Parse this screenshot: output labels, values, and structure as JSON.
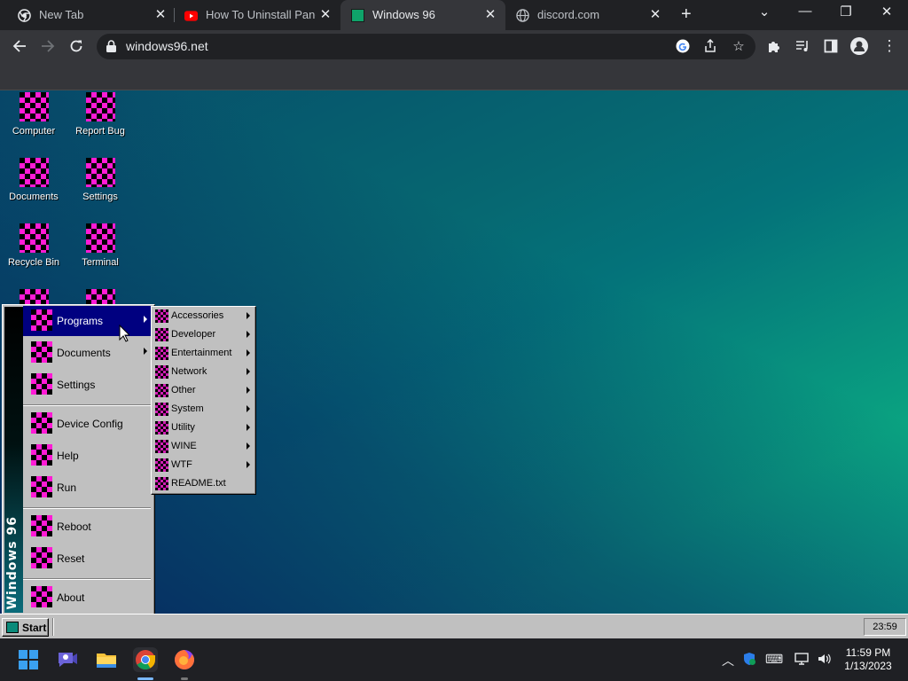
{
  "browser": {
    "tabs": [
      {
        "title": "New Tab",
        "favicon": "chrome-icon"
      },
      {
        "title": "How To Uninstall Pandz",
        "favicon": "youtube-icon"
      },
      {
        "title": "Windows 96",
        "favicon": "windows96-icon",
        "active": true
      },
      {
        "title": "discord.com",
        "favicon": "globe-icon"
      }
    ],
    "url": "windows96.net",
    "colors": {
      "frame": "#202124",
      "toolbar": "#35363a",
      "text": "#e8eaed"
    }
  },
  "desktop": {
    "icons": [
      {
        "label": "Computer"
      },
      {
        "label": "Report Bug"
      },
      {
        "label": "Documents"
      },
      {
        "label": "Settings"
      },
      {
        "label": "Recycle Bin"
      },
      {
        "label": "Terminal"
      }
    ]
  },
  "start_menu": {
    "brand": "Windows 96",
    "items": [
      {
        "label": "Programs",
        "submenu": true,
        "highlighted": true
      },
      {
        "label": "Documents",
        "submenu": true
      },
      {
        "label": "Settings"
      },
      {
        "label": "Device Config"
      },
      {
        "label": "Help"
      },
      {
        "label": "Run"
      },
      {
        "label": "Reboot"
      },
      {
        "label": "Reset"
      },
      {
        "label": "About"
      }
    ],
    "programs": [
      {
        "label": "Accessories",
        "submenu": true
      },
      {
        "label": "Developer",
        "submenu": true
      },
      {
        "label": "Entertainment",
        "submenu": true
      },
      {
        "label": "Network",
        "submenu": true
      },
      {
        "label": "Other",
        "submenu": true
      },
      {
        "label": "System",
        "submenu": true
      },
      {
        "label": "Utility",
        "submenu": true
      },
      {
        "label": "WINE",
        "submenu": true
      },
      {
        "label": "WTF",
        "submenu": true
      },
      {
        "label": "README.txt",
        "submenu": false
      }
    ]
  },
  "taskbar96": {
    "start_label": "Start",
    "clock": "23:59"
  },
  "windows_taskbar": {
    "apps": [
      "windows-start-icon",
      "meet-icon",
      "file-explorer-icon",
      "chrome-icon",
      "firefox-icon"
    ],
    "time": "11:59 PM",
    "date": "1/13/2023"
  }
}
